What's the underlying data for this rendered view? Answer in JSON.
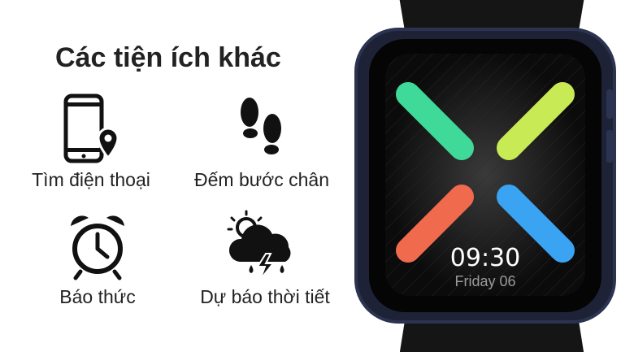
{
  "title": "Các tiện ích khác",
  "features": [
    {
      "label": "Tìm điện thoại",
      "icon": "phone-location-icon"
    },
    {
      "label": "Đếm bước chân",
      "icon": "footsteps-icon"
    },
    {
      "label": "Báo thức",
      "icon": "alarm-clock-icon"
    },
    {
      "label": "Dự báo thời tiết",
      "icon": "weather-storm-icon"
    }
  ],
  "watch": {
    "time": "09:30",
    "date": "Friday 06",
    "colors": {
      "green": "#3fd99a",
      "lime": "#c8ea55",
      "red": "#f06a4e",
      "blue": "#3aa3f2"
    }
  }
}
